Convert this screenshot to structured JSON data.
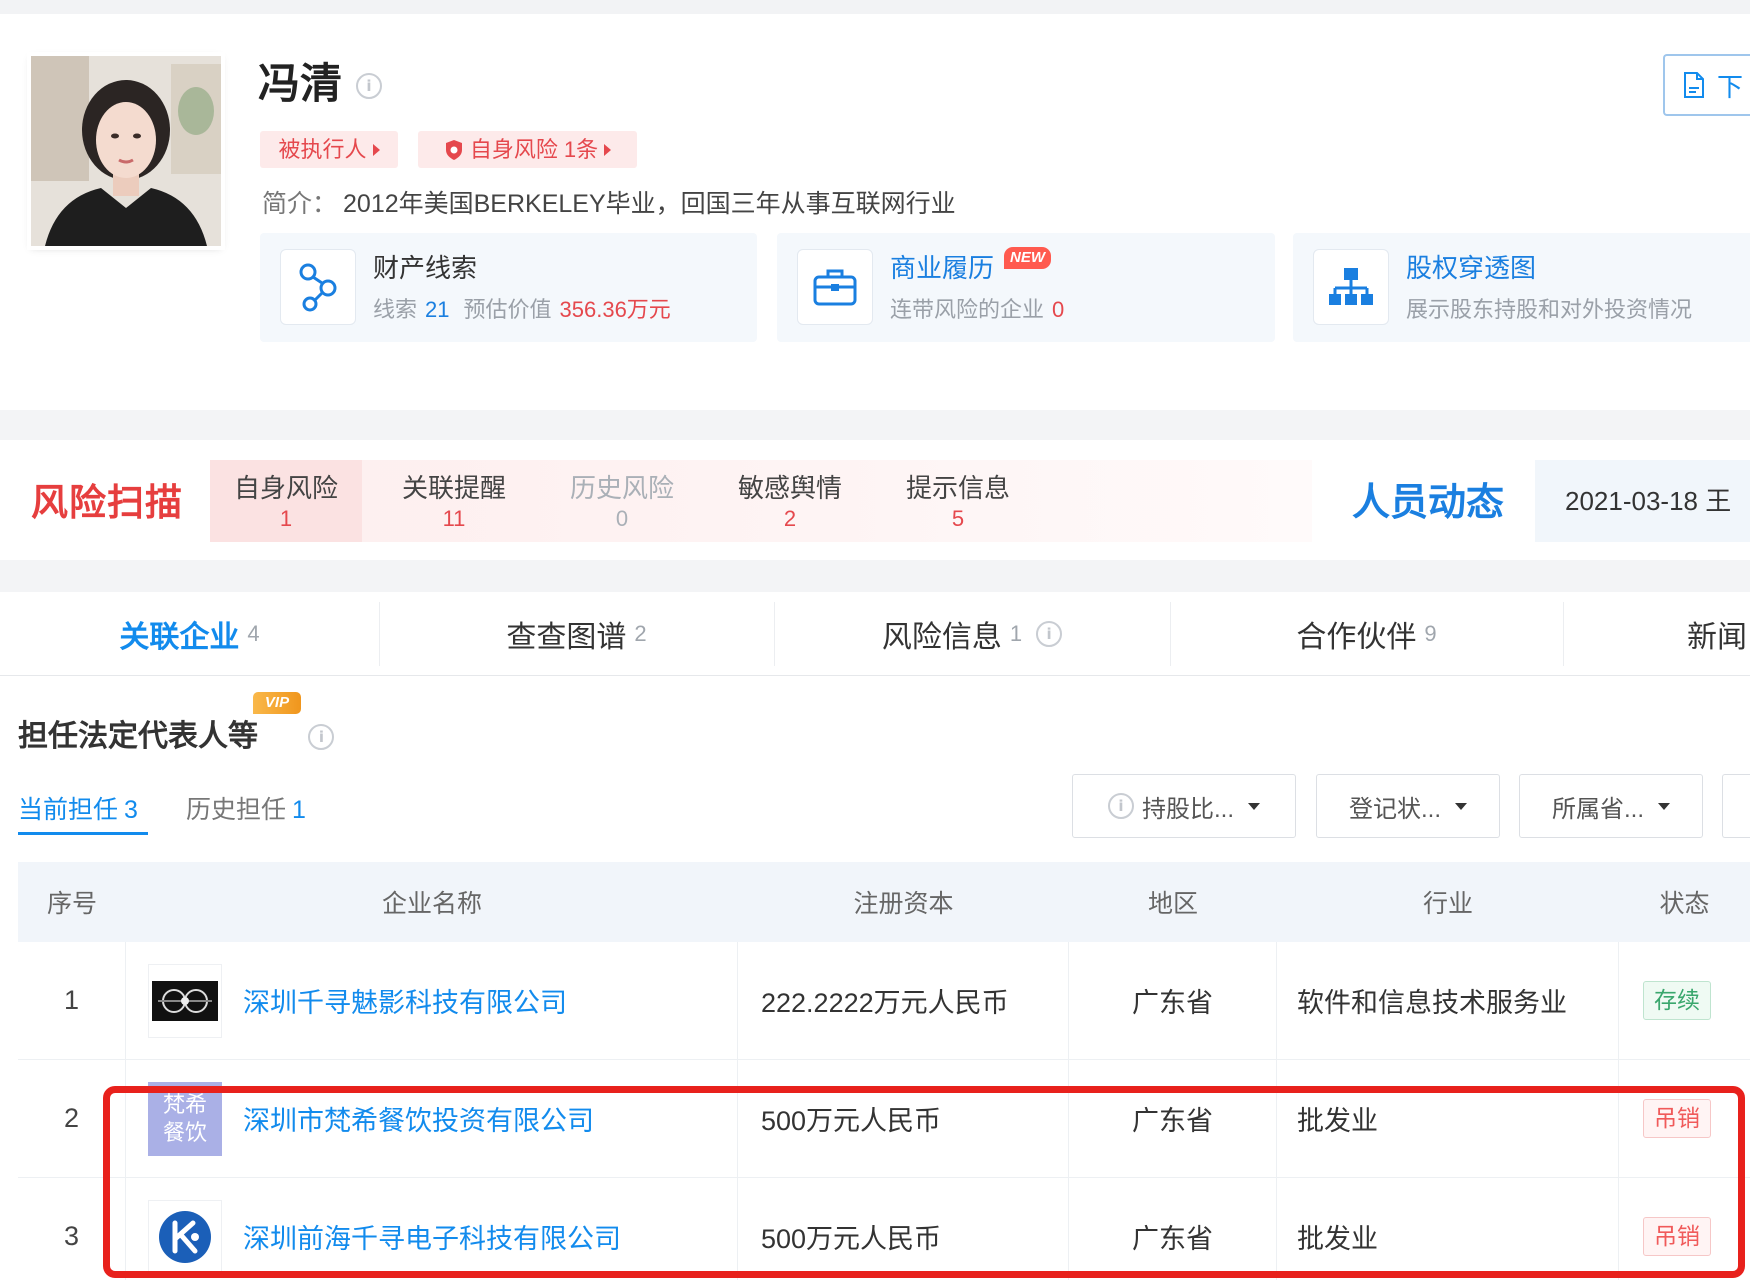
{
  "colors": {
    "brand_blue": "#128bed",
    "risk_red": "#e5484d",
    "status_active_green": "#3aa76d",
    "status_revoked_red": "#f05a5a",
    "highlight_red": "#e8211c"
  },
  "profile": {
    "name": "冯清",
    "name_info_icon": "info-icon",
    "tags": [
      {
        "label": "被执行人",
        "icon": "caret-right-icon"
      },
      {
        "label": "自身风险 1条",
        "icon": "shield-icon"
      }
    ],
    "intro_label": "简介：",
    "intro_text": "2012年美国BERKELEY毕业，回国三年从事互联网行业",
    "download": {
      "label": "下",
      "icon": "pdf-icon"
    }
  },
  "cards": [
    {
      "icon": "clue-link-icon",
      "title": "财产线索",
      "clue_label": "线索",
      "clue_count": "21",
      "value_label": "预估价值",
      "value": "356.36万元"
    },
    {
      "icon": "briefcase-icon",
      "title": "商业履历",
      "badge": "NEW",
      "risk_label": "连带风险的企业",
      "risk_count": "0"
    },
    {
      "icon": "org-chart-icon",
      "title": "股权穿透图",
      "desc": "展示股东持股和对外投资情况"
    }
  ],
  "risk_scan": {
    "title": "风险扫描",
    "items": [
      {
        "label": "自身风险",
        "count": "1"
      },
      {
        "label": "关联提醒",
        "count": "11"
      },
      {
        "label": "历史风险",
        "count": "0"
      },
      {
        "label": "敏感舆情",
        "count": "2"
      },
      {
        "label": "提示信息",
        "count": "5"
      }
    ]
  },
  "personnel": {
    "title": "人员动态",
    "latest": "2021-03-18 王"
  },
  "tabs": [
    {
      "label": "关联企业",
      "count": "4",
      "active": true
    },
    {
      "label": "查查图谱",
      "count": "2"
    },
    {
      "label": "风险信息",
      "count": "1"
    },
    {
      "label": "合作伙伴",
      "count": "9"
    },
    {
      "label": "新闻"
    }
  ],
  "section": {
    "title": "担任法定代表人等",
    "vip": "VIP",
    "subtabs": [
      {
        "label": "当前担任",
        "count": "3",
        "active": true
      },
      {
        "label": "历史担任",
        "count": "1"
      }
    ],
    "filters": [
      {
        "label": "持股比...",
        "icon": "info-icon"
      },
      {
        "label": "登记状..."
      },
      {
        "label": "所属省..."
      }
    ]
  },
  "table": {
    "headers": [
      "序号",
      "企业名称",
      "注册资本",
      "地区",
      "行业",
      "状态"
    ],
    "rows": [
      {
        "index": "1",
        "name": "深圳千寻魅影科技有限公司",
        "capital": "222.2222万元人民币",
        "region": "广东省",
        "industry": "软件和信息技术服务业",
        "status": "存续"
      },
      {
        "index": "2",
        "logo_lines": [
          "梵希",
          "餐饮"
        ],
        "name": "深圳市梵希餐饮投资有限公司",
        "capital": "500万元人民币",
        "region": "广东省",
        "industry": "批发业",
        "status": "吊销"
      },
      {
        "index": "3",
        "name": "深圳前海千寻电子科技有限公司",
        "capital": "500万元人民币",
        "region": "广东省",
        "industry": "批发业",
        "status": "吊销"
      }
    ]
  }
}
